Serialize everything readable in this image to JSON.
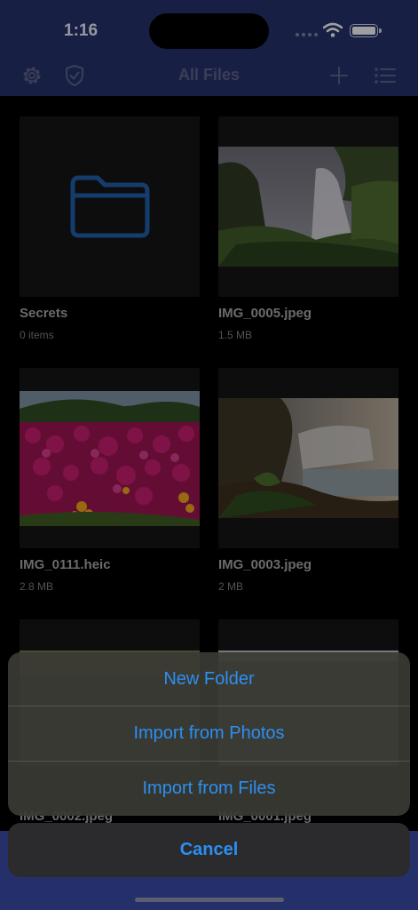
{
  "status": {
    "time": "1:16",
    "signal_icon": "signal-dots-icon",
    "wifi_icon": "wifi-icon",
    "battery_icon": "battery-icon"
  },
  "nav": {
    "title": "All Files",
    "left_icons": [
      "gear-icon",
      "shield-check-icon"
    ],
    "right_icons": [
      "plus-icon",
      "list-icon"
    ]
  },
  "files": [
    {
      "name": "Secrets",
      "meta": "0 items",
      "kind": "folder"
    },
    {
      "name": "IMG_0005.jpeg",
      "meta": "1.5 MB",
      "kind": "image"
    },
    {
      "name": "IMG_0111.heic",
      "meta": "2.8 MB",
      "kind": "image"
    },
    {
      "name": "IMG_0003.jpeg",
      "meta": "2 MB",
      "kind": "image"
    },
    {
      "name": "IMG_0002.jpeg",
      "meta": "",
      "kind": "image"
    },
    {
      "name": "IMG_0001.jpeg",
      "meta": "",
      "kind": "image"
    }
  ],
  "action_sheet": {
    "items": [
      "New Folder",
      "Import from Photos",
      "Import from Files"
    ],
    "cancel": "Cancel"
  },
  "colors": {
    "accent": "#2c8ff2",
    "bar": "#25306a",
    "folder": "#1f5fa8"
  }
}
